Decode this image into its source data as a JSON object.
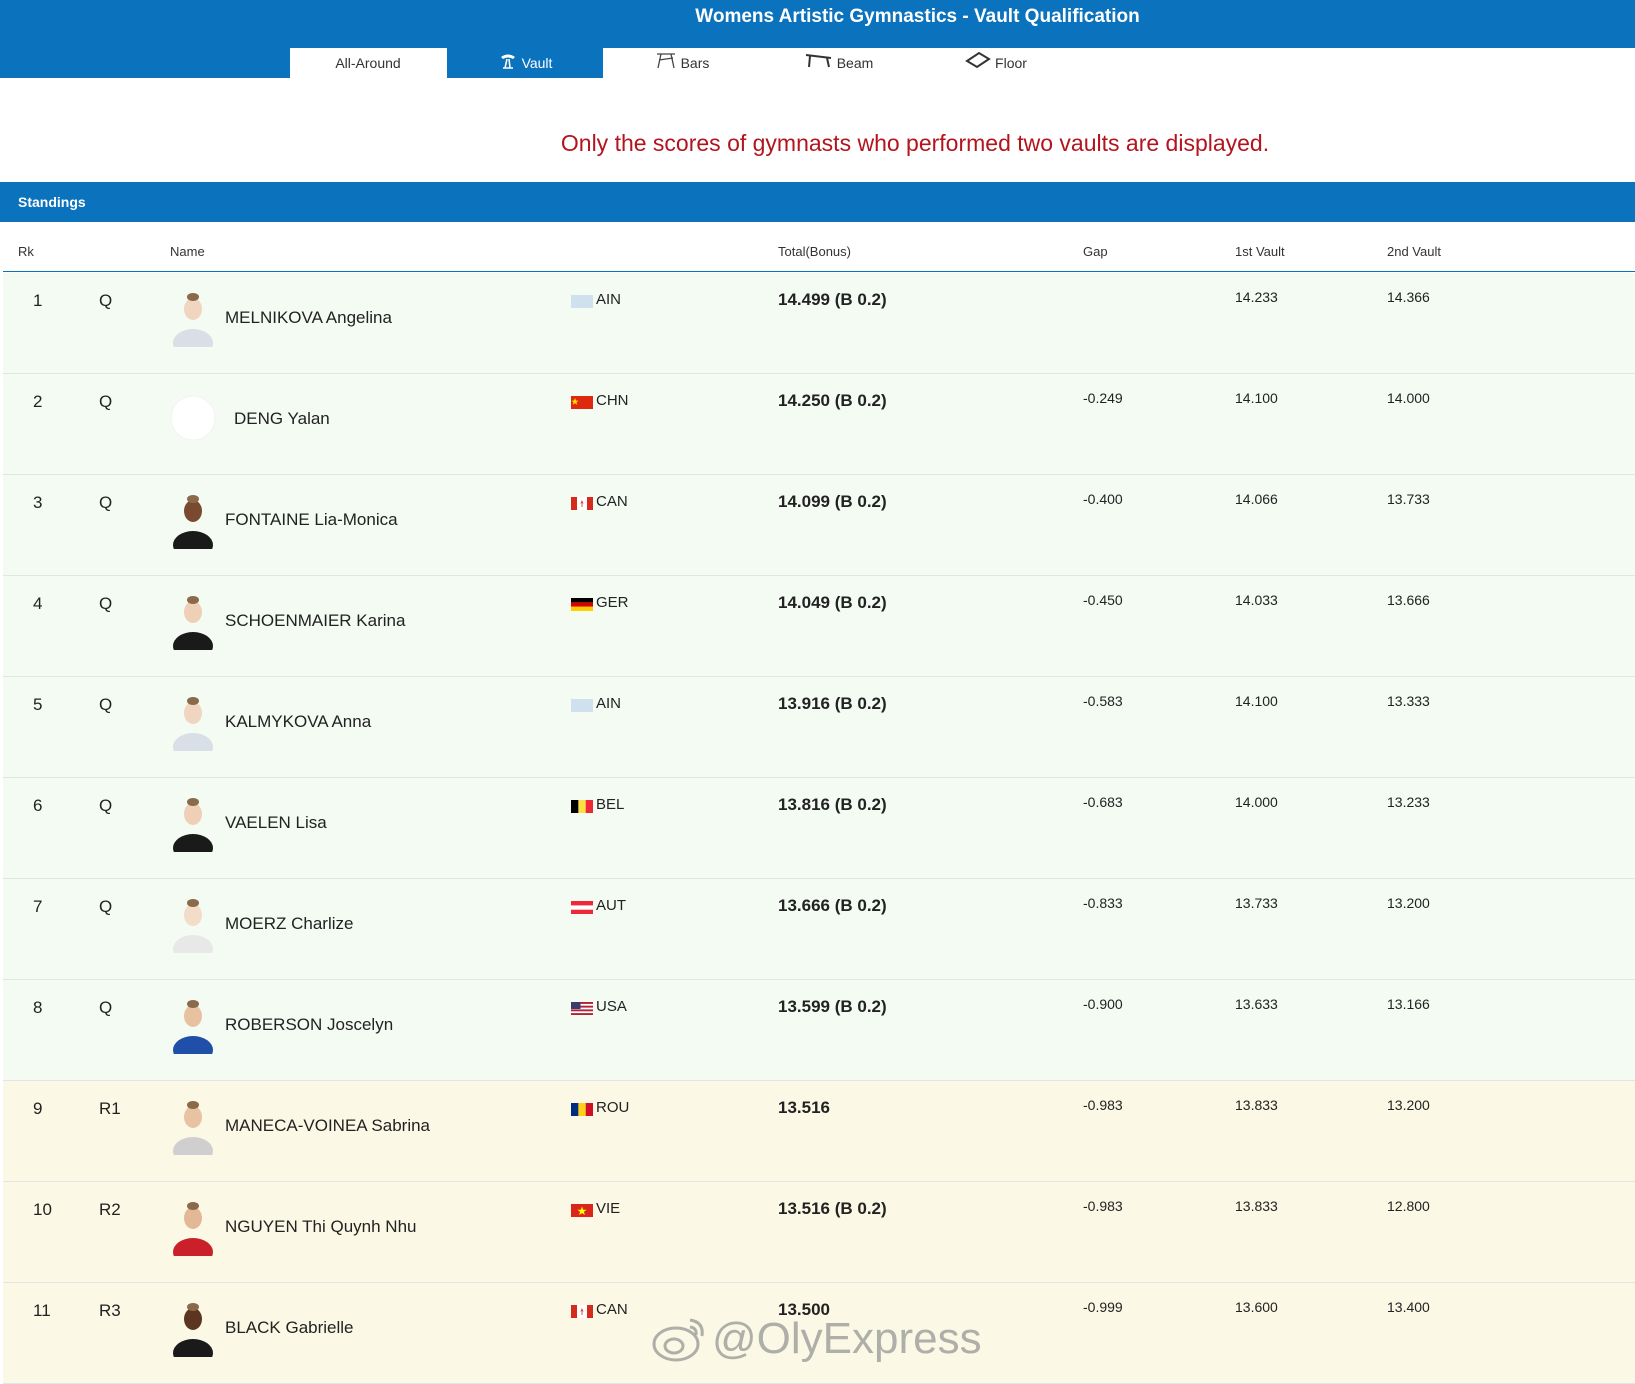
{
  "header": {
    "title": "Womens Artistic Gymnastics - Vault Qualification"
  },
  "tabs": [
    {
      "label": "All-Around",
      "icon": "none",
      "active": false
    },
    {
      "label": "Vault",
      "icon": "vault-icon",
      "active": true
    },
    {
      "label": "Bars",
      "icon": "bars-icon",
      "active": false
    },
    {
      "label": "Beam",
      "icon": "beam-icon",
      "active": false
    },
    {
      "label": "Floor",
      "icon": "floor-icon",
      "active": false
    }
  ],
  "notice": "Only the scores of gymnasts who performed two vaults are displayed.",
  "standings": {
    "title": "Standings",
    "columns": {
      "rk": "Rk",
      "name": "Name",
      "total": "Total(Bonus)",
      "gap": "Gap",
      "v1": "1st Vault",
      "v2": "2nd Vault"
    },
    "rows": [
      {
        "rk": "1",
        "q": "Q",
        "name": "MELNIKOVA Angelina",
        "noc": "AIN",
        "total": "14.499 (B 0.2)",
        "gap": "",
        "v1": "14.233",
        "v2": "14.366"
      },
      {
        "rk": "2",
        "q": "Q",
        "name": "DENG Yalan",
        "noc": "CHN",
        "total": "14.250 (B 0.2)",
        "gap": "-0.249",
        "v1": "14.100",
        "v2": "14.000"
      },
      {
        "rk": "3",
        "q": "Q",
        "name": "FONTAINE Lia-Monica",
        "noc": "CAN",
        "total": "14.099 (B 0.2)",
        "gap": "-0.400",
        "v1": "14.066",
        "v2": "13.733"
      },
      {
        "rk": "4",
        "q": "Q",
        "name": "SCHOENMAIER Karina",
        "noc": "GER",
        "total": "14.049 (B 0.2)",
        "gap": "-0.450",
        "v1": "14.033",
        "v2": "13.666"
      },
      {
        "rk": "5",
        "q": "Q",
        "name": "KALMYKOVA Anna",
        "noc": "AIN",
        "total": "13.916 (B 0.2)",
        "gap": "-0.583",
        "v1": "14.100",
        "v2": "13.333"
      },
      {
        "rk": "6",
        "q": "Q",
        "name": "VAELEN Lisa",
        "noc": "BEL",
        "total": "13.816 (B 0.2)",
        "gap": "-0.683",
        "v1": "14.000",
        "v2": "13.233"
      },
      {
        "rk": "7",
        "q": "Q",
        "name": "MOERZ Charlize",
        "noc": "AUT",
        "total": "13.666 (B 0.2)",
        "gap": "-0.833",
        "v1": "13.733",
        "v2": "13.200"
      },
      {
        "rk": "8",
        "q": "Q",
        "name": "ROBERSON Joscelyn",
        "noc": "USA",
        "total": "13.599 (B 0.2)",
        "gap": "-0.900",
        "v1": "13.633",
        "v2": "13.166"
      },
      {
        "rk": "9",
        "q": "R1",
        "name": "MANECA-VOINEA Sabrina",
        "noc": "ROU",
        "total": "13.516",
        "gap": "-0.983",
        "v1": "13.833",
        "v2": "13.200"
      },
      {
        "rk": "10",
        "q": "R2",
        "name": "NGUYEN Thi Quynh Nhu",
        "noc": "VIE",
        "total": "13.516 (B 0.2)",
        "gap": "-0.983",
        "v1": "13.833",
        "v2": "12.800"
      },
      {
        "rk": "11",
        "q": "R3",
        "name": "BLACK Gabrielle",
        "noc": "CAN",
        "total": "13.500",
        "gap": "-0.999",
        "v1": "13.600",
        "v2": "13.400"
      }
    ]
  },
  "watermark": "@OlyExpress",
  "colors": {
    "brand_blue": "#0b72bd",
    "notice_red": "#b3141d",
    "qualified_row": "#f3fbf3",
    "reserve_row": "#fbf9e5"
  }
}
